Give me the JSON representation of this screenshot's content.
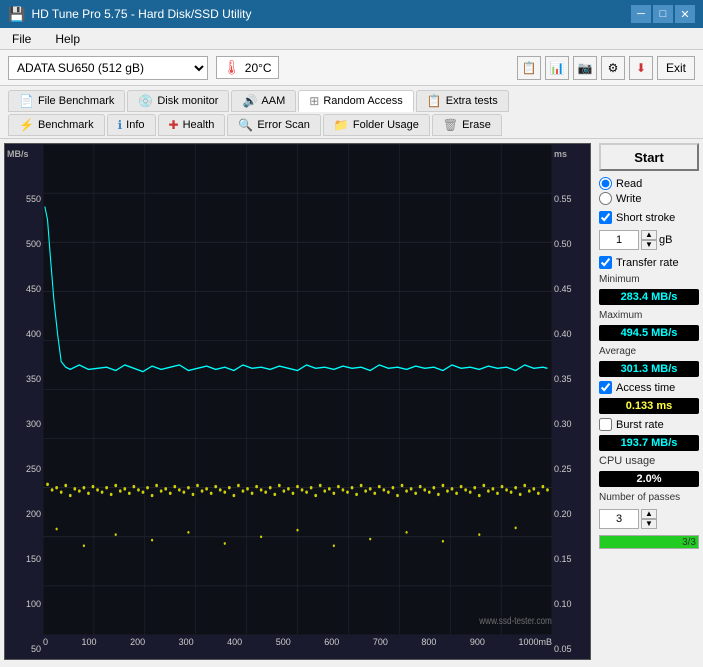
{
  "titleBar": {
    "title": "HD Tune Pro 5.75 - Hard Disk/SSD Utility",
    "btnMin": "─",
    "btnMax": "□",
    "btnClose": "✕"
  },
  "menuBar": {
    "items": [
      "File",
      "Help"
    ]
  },
  "toolbar": {
    "driveLabel": "ADATA SU650 (512 gB)",
    "temperature": "20°C",
    "exitLabel": "Exit"
  },
  "tabs": {
    "row1": [
      {
        "label": "File Benchmark",
        "icon": "📄",
        "active": false
      },
      {
        "label": "Disk monitor",
        "icon": "💿",
        "active": false
      },
      {
        "label": "AAM",
        "icon": "🔊",
        "active": false
      },
      {
        "label": "Random Access",
        "icon": "🔲",
        "active": true
      },
      {
        "label": "Extra tests",
        "icon": "📋",
        "active": false
      }
    ],
    "row2": [
      {
        "label": "Benchmark",
        "icon": "⚡",
        "active": false
      },
      {
        "label": "Info",
        "icon": "ℹ",
        "active": false
      },
      {
        "label": "Health",
        "icon": "➕",
        "active": false
      },
      {
        "label": "Error Scan",
        "icon": "🔍",
        "active": false
      },
      {
        "label": "Folder Usage",
        "icon": "📁",
        "active": false
      },
      {
        "label": "Erase",
        "icon": "🗑",
        "active": false
      }
    ]
  },
  "chart": {
    "yAxisLeftTitle": "MB/s",
    "yAxisRightTitle": "ms",
    "yLabelsLeft": [
      "550",
      "500",
      "450",
      "400",
      "350",
      "300",
      "250",
      "200",
      "150",
      "100",
      "50"
    ],
    "yLabelsRight": [
      "0.55",
      "0.50",
      "0.45",
      "0.40",
      "0.35",
      "0.30",
      "0.25",
      "0.20",
      "0.15",
      "0.10",
      "0.05"
    ],
    "xLabels": [
      "0",
      "100",
      "200",
      "300",
      "400",
      "500",
      "600",
      "700",
      "800",
      "900",
      "1000mB"
    ],
    "watermark": "www.ssd-tester.com.au"
  },
  "rightPanel": {
    "startLabel": "Start",
    "readLabel": "Read",
    "writeLabel": "Write",
    "shortStrokeLabel": "Short stroke",
    "shortStrokeValue": "1",
    "shortStrokeUnit": "gB",
    "transferRateLabel": "Transfer rate",
    "minimumLabel": "Minimum",
    "minimumValue": "283.4 MB/s",
    "maximumLabel": "Maximum",
    "maximumValue": "494.5 MB/s",
    "averageLabel": "Average",
    "averageValue": "301.3 MB/s",
    "accessTimeLabel": "Access time",
    "accessTimeValue": "0.133 ms",
    "burstRateLabel": "Burst rate",
    "burstRateValue": "193.7 MB/s",
    "cpuUsageLabel": "CPU usage",
    "cpuUsageValue": "2.0%",
    "passesLabel": "Number of passes",
    "passesValue": "3",
    "progressLabel": "3/3"
  }
}
